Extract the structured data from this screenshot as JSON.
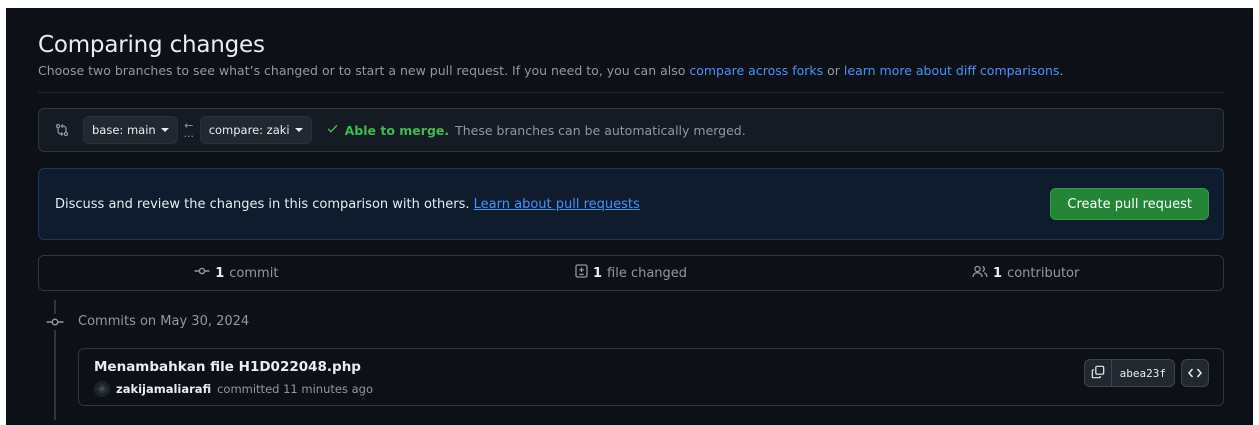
{
  "header": {
    "title": "Comparing changes",
    "subtitle_text1": "Choose two branches to see what’s changed or to start a new pull request. If you need to, you can also ",
    "subtitle_link1": "compare across forks",
    "subtitle_text2": " or ",
    "subtitle_link2": "learn more about diff comparisons",
    "subtitle_text3": "."
  },
  "range": {
    "base_label": "base: main",
    "compare_label": "compare: zaki",
    "arrow_glyph": "←",
    "dots": "...",
    "merge_status": "Able to merge.",
    "merge_message": "These branches can be automatically merged."
  },
  "flash": {
    "text": "Discuss and review the changes in this comparison with others. ",
    "link": "Learn about pull requests",
    "button": "Create pull request"
  },
  "summary": {
    "commits_count": "1",
    "commits_label": "commit",
    "files_count": "1",
    "files_label": "file changed",
    "contributors_count": "1",
    "contributors_label": "contributor"
  },
  "commits": {
    "heading": "Commits on May 30, 2024",
    "items": [
      {
        "title": "Menambahkan file H1D022048.php",
        "author": "zakijamaliarafi",
        "meta": "committed 11 minutes ago",
        "sha": "abea23f"
      }
    ]
  },
  "colors": {
    "background": "#0d1117",
    "link": "#4493f8",
    "success": "#3fb950",
    "primary_button": "#238636",
    "muted_text": "#9198a1"
  },
  "icons": [
    "git-compare-icon",
    "arrow-left-icon",
    "check-icon",
    "git-commit-icon",
    "file-diff-icon",
    "people-icon",
    "copy-icon",
    "code-icon"
  ]
}
